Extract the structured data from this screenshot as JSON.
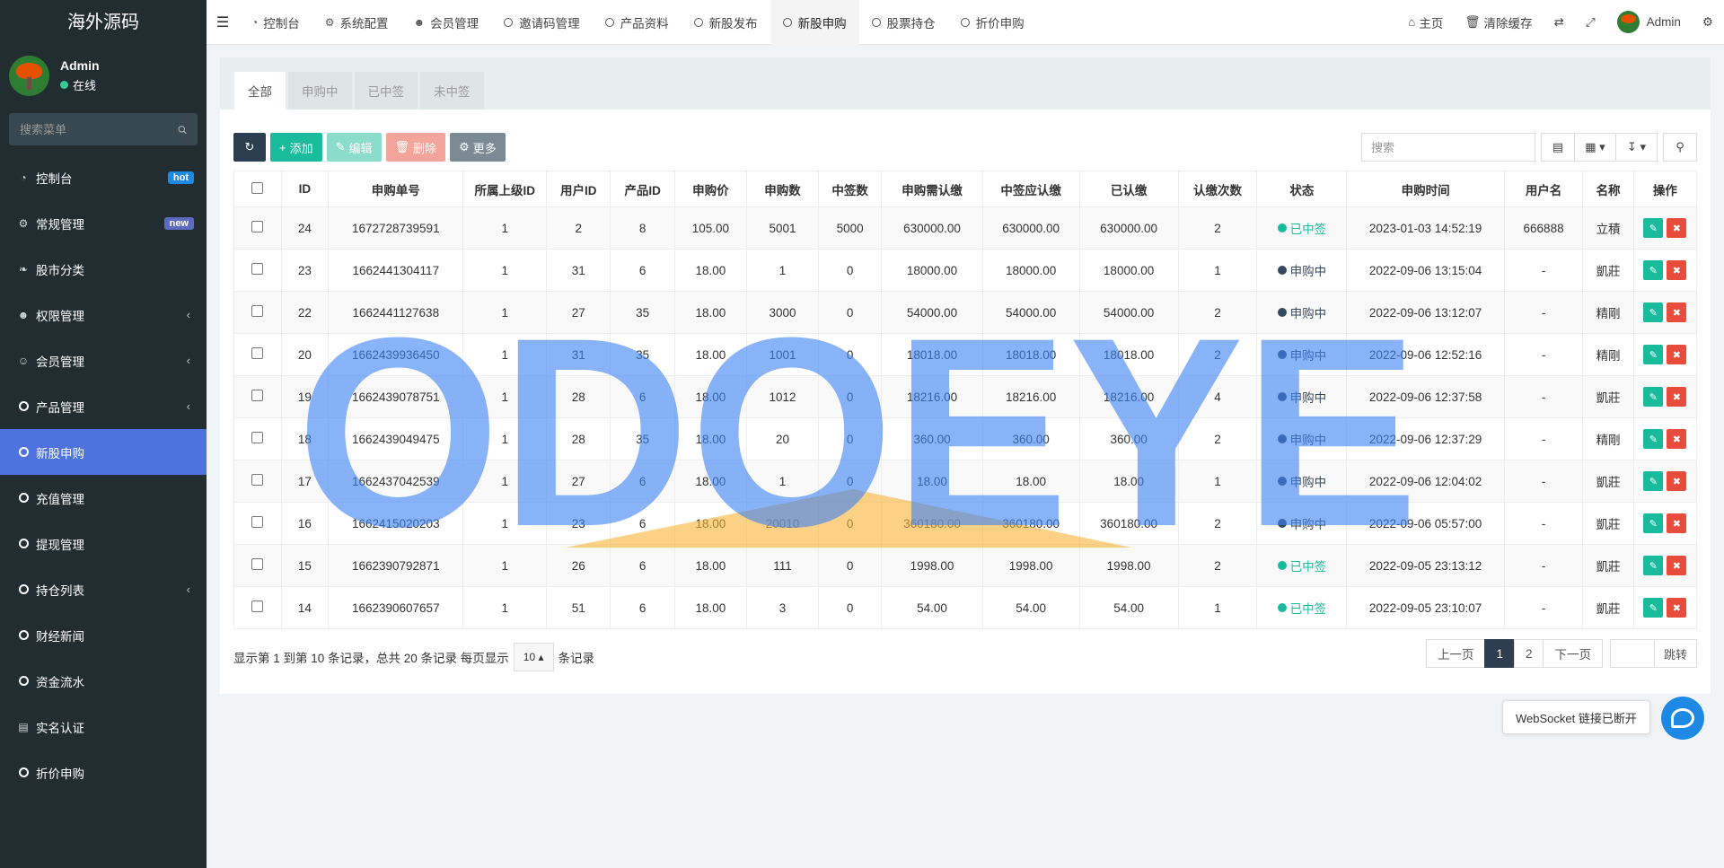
{
  "app": {
    "title": "海外源码"
  },
  "user": {
    "name": "Admin",
    "status": "在线"
  },
  "sidebar": {
    "search_placeholder": "搜索菜单",
    "items": [
      {
        "label": "控制台",
        "icon": "dashboard-icon",
        "badge": "hot"
      },
      {
        "label": "常规管理",
        "icon": "cogs-icon",
        "badge": "new"
      },
      {
        "label": "股市分类",
        "icon": "leaf-icon"
      },
      {
        "label": "权限管理",
        "icon": "users-icon"
      },
      {
        "label": "会员管理",
        "icon": "user-circle-icon"
      },
      {
        "label": "产品管理",
        "icon": "circle-icon"
      },
      {
        "label": "新股申购",
        "icon": "circle-icon"
      },
      {
        "label": "充值管理",
        "icon": "circle-icon"
      },
      {
        "label": "提现管理",
        "icon": "circle-icon"
      },
      {
        "label": "持仓列表",
        "icon": "circle-icon"
      },
      {
        "label": "财经新闻",
        "icon": "circle-icon"
      },
      {
        "label": "资金流水",
        "icon": "circle-icon"
      },
      {
        "label": "实名认证",
        "icon": "id-card-icon"
      },
      {
        "label": "折价申购",
        "icon": "circle-icon"
      }
    ]
  },
  "topnav": {
    "tabs": [
      {
        "label": "控制台"
      },
      {
        "label": "系统配置"
      },
      {
        "label": "会员管理"
      },
      {
        "label": "邀请码管理"
      },
      {
        "label": "产品资料"
      },
      {
        "label": "新股发布"
      },
      {
        "label": "新股申购"
      },
      {
        "label": "股票持仓"
      },
      {
        "label": "折价申购"
      }
    ],
    "home": "主页",
    "clear_cache": "清除缓存",
    "admin": "Admin"
  },
  "panel_tabs": [
    "全部",
    "申购中",
    "已中签",
    "未中签"
  ],
  "toolbar": {
    "add": "添加",
    "edit": "编辑",
    "delete": "删除",
    "more": "更多",
    "search_placeholder": "搜索"
  },
  "table": {
    "headers": [
      "ID",
      "申购单号",
      "所属上级ID",
      "用户ID",
      "产品ID",
      "申购价",
      "申购数",
      "中签数",
      "申购需认缴",
      "中签应认缴",
      "已认缴",
      "认缴次数",
      "状态",
      "申购时间",
      "用户名",
      "名称",
      "操作"
    ],
    "rows": [
      [
        "24",
        "1672728739591",
        "1",
        "2",
        "8",
        "105.00",
        "5001",
        "5000",
        "630000.00",
        "630000.00",
        "630000.00",
        "2",
        "已中签",
        "2023-01-03 14:52:19",
        "666888",
        "立積"
      ],
      [
        "23",
        "1662441304117",
        "1",
        "31",
        "6",
        "18.00",
        "1",
        "0",
        "18000.00",
        "18000.00",
        "18000.00",
        "1",
        "申购中",
        "2022-09-06 13:15:04",
        "-",
        "凱莊"
      ],
      [
        "22",
        "1662441127638",
        "1",
        "27",
        "35",
        "18.00",
        "3000",
        "0",
        "54000.00",
        "54000.00",
        "54000.00",
        "2",
        "申购中",
        "2022-09-06 13:12:07",
        "-",
        "精剛"
      ],
      [
        "20",
        "1662439936450",
        "1",
        "31",
        "35",
        "18.00",
        "1001",
        "0",
        "18018.00",
        "18018.00",
        "18018.00",
        "2",
        "申购中",
        "2022-09-06 12:52:16",
        "-",
        "精剛"
      ],
      [
        "19",
        "1662439078751",
        "1",
        "28",
        "6",
        "18.00",
        "1012",
        "0",
        "18216.00",
        "18216.00",
        "18216.00",
        "4",
        "申购中",
        "2022-09-06 12:37:58",
        "-",
        "凱莊"
      ],
      [
        "18",
        "1662439049475",
        "1",
        "28",
        "35",
        "18.00",
        "20",
        "0",
        "360.00",
        "360.00",
        "360.00",
        "2",
        "申购中",
        "2022-09-06 12:37:29",
        "-",
        "精剛"
      ],
      [
        "17",
        "1662437042539",
        "1",
        "27",
        "6",
        "18.00",
        "1",
        "0",
        "18.00",
        "18.00",
        "18.00",
        "1",
        "申购中",
        "2022-09-06 12:04:02",
        "-",
        "凱莊"
      ],
      [
        "16",
        "1662415020203",
        "1",
        "23",
        "6",
        "18.00",
        "20010",
        "0",
        "360180.00",
        "360180.00",
        "360180.00",
        "2",
        "申购中",
        "2022-09-06 05:57:00",
        "-",
        "凱莊"
      ],
      [
        "15",
        "1662390792871",
        "1",
        "26",
        "6",
        "18.00",
        "111",
        "0",
        "1998.00",
        "1998.00",
        "1998.00",
        "2",
        "已中签",
        "2022-09-05 23:13:12",
        "-",
        "凱莊"
      ],
      [
        "14",
        "1662390607657",
        "1",
        "51",
        "6",
        "18.00",
        "3",
        "0",
        "54.00",
        "54.00",
        "54.00",
        "1",
        "已中签",
        "2022-09-05 23:10:07",
        "-",
        "凱莊"
      ]
    ]
  },
  "pagination": {
    "info_prefix": "显示第 1 到第 10 条记录，总共 20 条记录 每页显示",
    "page_size": "10",
    "info_suffix": "条记录",
    "prev": "上一页",
    "pages": [
      "1",
      "2"
    ],
    "next": "下一页",
    "jump": "跳转"
  },
  "toast": "WebSocket 链接已断开",
  "watermark": "ODOEYE",
  "colors": {
    "sidebar_bg": "#222d32",
    "active_menu": "#4e73df",
    "success": "#18bc9c",
    "danger": "#e74c3c",
    "primary_dark": "#2c3e50"
  }
}
